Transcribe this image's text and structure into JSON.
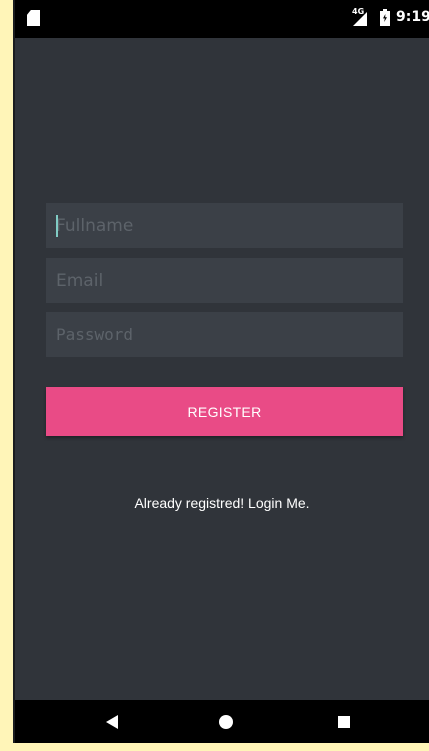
{
  "status_bar": {
    "network": "4G",
    "time": "9:19",
    "icons": [
      "sd-card-icon",
      "signal-icon",
      "battery-charging-icon"
    ]
  },
  "form": {
    "fullname_placeholder": "Fullname",
    "fullname_value": "",
    "email_placeholder": "Email",
    "email_value": "",
    "password_placeholder": "Password",
    "password_value": ""
  },
  "register_button": {
    "label": "REGISTER",
    "color": "#e94b86"
  },
  "login_link": "Already registred! Login Me.",
  "nav_bar": {
    "icons": [
      "back-icon",
      "home-icon",
      "recents-icon"
    ]
  },
  "colors": {
    "background": "#30343a",
    "field_background": "#3b4047",
    "accent": "#e94b86",
    "page_margin": "#fff5b8"
  }
}
